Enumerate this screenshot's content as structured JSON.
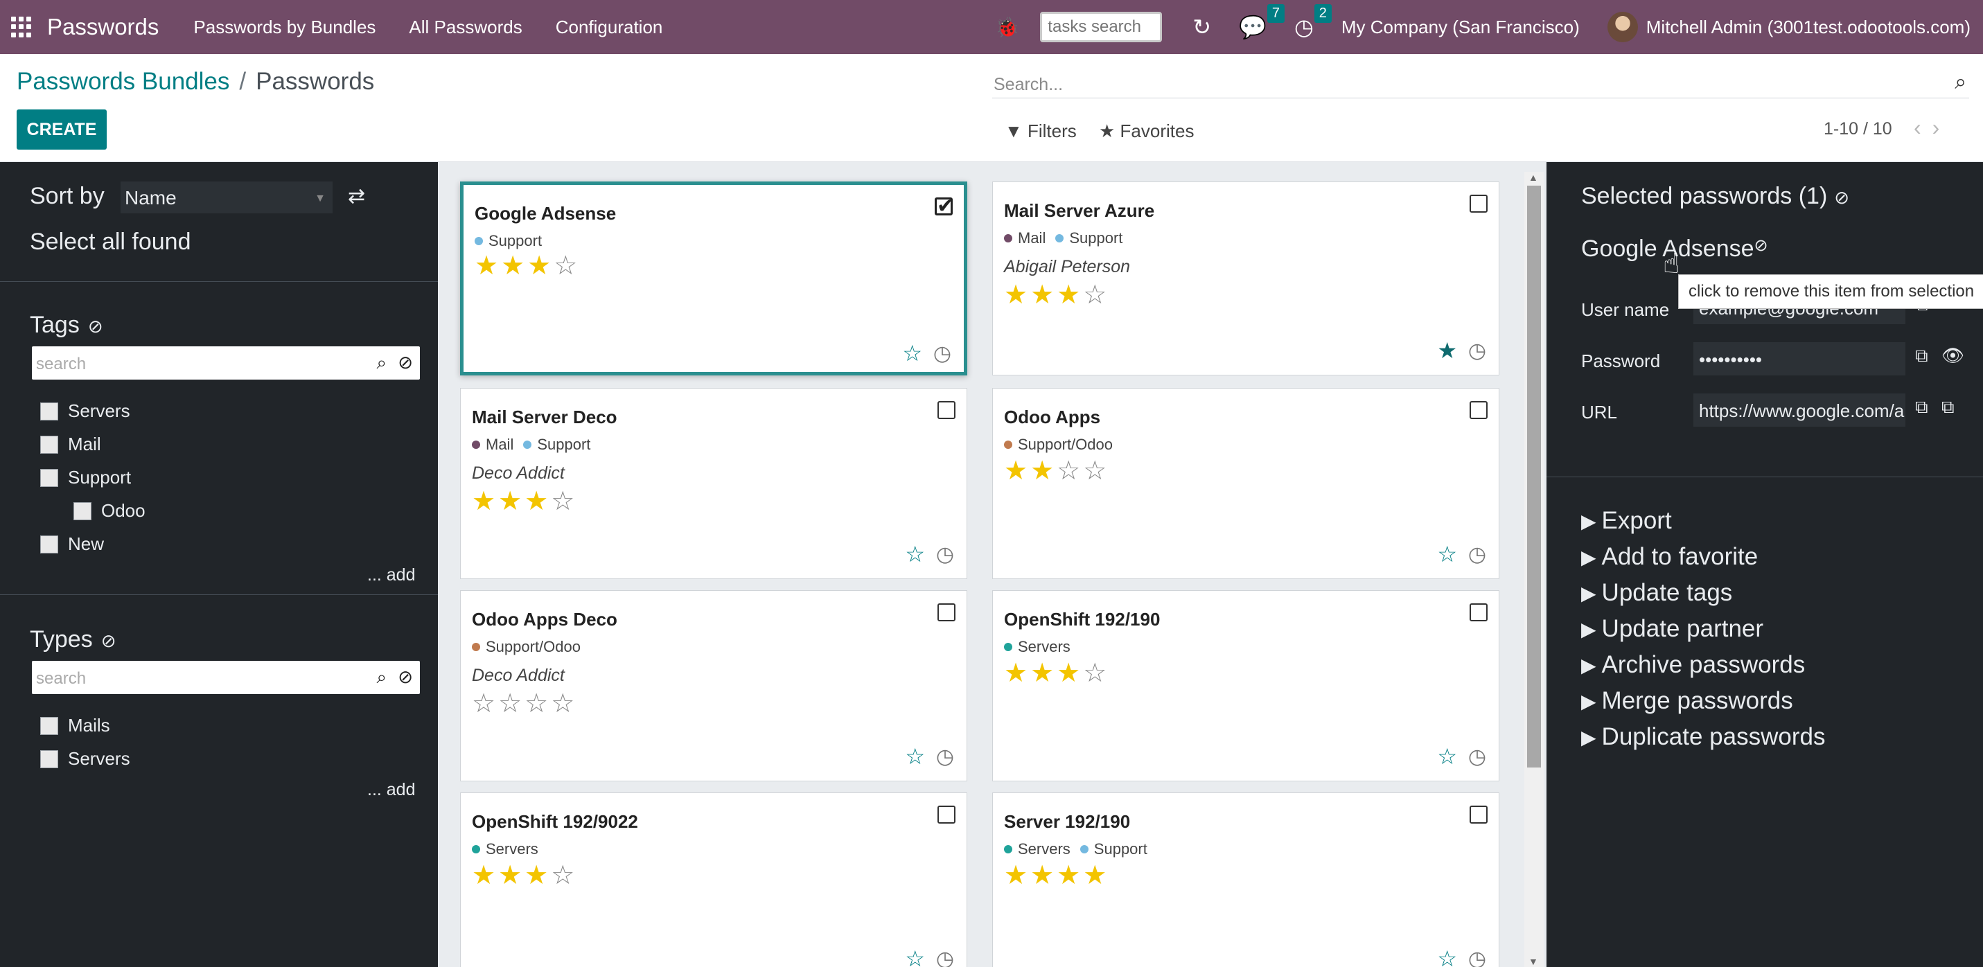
{
  "topnav": {
    "brand": "Passwords",
    "menu": [
      "Passwords by Bundles",
      "All Passwords",
      "Configuration"
    ],
    "tasks_search_placeholder": "tasks search",
    "messages_badge": "7",
    "activities_badge": "2",
    "company": "My Company (San Francisco)",
    "user": "Mitchell Admin (3001test.odootools.com)"
  },
  "control": {
    "breadcrumb_parent": "Passwords Bundles",
    "breadcrumb_current": "Passwords",
    "create_label": "CREATE",
    "search_placeholder": "Search...",
    "filters_label": "Filters",
    "favorites_label": "Favorites",
    "pager": "1-10 / 10"
  },
  "left": {
    "sort_label": "Sort by",
    "sort_value": "Name",
    "select_all": "Select all found",
    "tags_title": "Tags",
    "tags_search_placeholder": "search",
    "tags": [
      "Servers",
      "Mail",
      "Support",
      "Odoo",
      "New"
    ],
    "tags_add": "... add",
    "types_title": "Types",
    "types_search_placeholder": "search",
    "types": [
      "Mails",
      "Servers"
    ],
    "types_add": "... add"
  },
  "cards": [
    {
      "title": "Google Adsense",
      "tags": [
        {
          "name": "Support",
          "color": "#74b9e0"
        }
      ],
      "partner": "",
      "rating": 3,
      "checked": true,
      "favorite": false
    },
    {
      "title": "Mail Server Azure",
      "tags": [
        {
          "name": "Mail",
          "color": "#714B67"
        },
        {
          "name": "Support",
          "color": "#74b9e0"
        }
      ],
      "partner": "Abigail Peterson",
      "rating": 3,
      "checked": false,
      "favorite": true
    },
    {
      "title": "Mail Server Deco",
      "tags": [
        {
          "name": "Mail",
          "color": "#714B67"
        },
        {
          "name": "Support",
          "color": "#74b9e0"
        }
      ],
      "partner": "Deco Addict",
      "rating": 3,
      "checked": false,
      "favorite": false
    },
    {
      "title": "Odoo Apps",
      "tags": [
        {
          "name": "Support/Odoo",
          "color": "#c07a4e"
        }
      ],
      "partner": "",
      "rating": 2,
      "checked": false,
      "favorite": false
    },
    {
      "title": "Odoo Apps Deco",
      "tags": [
        {
          "name": "Support/Odoo",
          "color": "#c07a4e"
        }
      ],
      "partner": "Deco Addict",
      "rating": 0,
      "checked": false,
      "favorite": false
    },
    {
      "title": "OpenShift 192/190",
      "tags": [
        {
          "name": "Servers",
          "color": "#1fa39a"
        }
      ],
      "partner": "",
      "rating": 3,
      "checked": false,
      "favorite": false
    },
    {
      "title": "OpenShift 192/9022",
      "tags": [
        {
          "name": "Servers",
          "color": "#1fa39a"
        }
      ],
      "partner": "",
      "rating": 3,
      "checked": false,
      "favorite": false
    },
    {
      "title": "Server 192/190",
      "tags": [
        {
          "name": "Servers",
          "color": "#1fa39a"
        },
        {
          "name": "Support",
          "color": "#74b9e0"
        }
      ],
      "partner": "",
      "rating": 4,
      "checked": false,
      "favorite": false
    }
  ],
  "right": {
    "selected_title": "Selected passwords (1)",
    "item_title": "Google Adsense",
    "tooltip": "click to remove this item from selection",
    "username_label": "User name",
    "username_value": "example@google.com",
    "password_label": "Password",
    "password_value": "••••••••••",
    "url_label": "URL",
    "url_value": "https://www.google.com/a",
    "actions": [
      "Export",
      "Add to favorite",
      "Update tags",
      "Update partner",
      "Archive passwords",
      "Merge passwords",
      "Duplicate passwords"
    ]
  },
  "colors": {
    "brand": "#714B67",
    "accent": "#017e84",
    "star": "#f3c400",
    "panel": "#212529"
  }
}
